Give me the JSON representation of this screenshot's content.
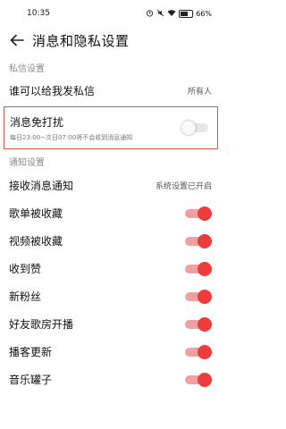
{
  "status_bar": {
    "time": "10:35",
    "battery": "66%",
    "icons": [
      "alarm-icon",
      "mute-icon",
      "wifi-icon",
      "battery-icon"
    ]
  },
  "header": {
    "title": "消息和隐私设置",
    "back_icon": "arrow-left-icon"
  },
  "private_message": {
    "section_title": "私信设置",
    "who_can_message_label": "谁可以给我发私信",
    "who_can_message_value": "所有人"
  },
  "do_not_disturb": {
    "label": "消息免打扰",
    "description": "每日23:00~次日07:00将不会收到消息通知",
    "enabled": false,
    "highlight_color": "#e2574c"
  },
  "notification": {
    "section_title": "通知设置",
    "receive_label": "接收消息通知",
    "receive_value": "系统设置已开启",
    "items": [
      {
        "label": "歌单被收藏",
        "enabled": true
      },
      {
        "label": "视频被收藏",
        "enabled": true
      },
      {
        "label": "收到赞",
        "enabled": true
      },
      {
        "label": "新粉丝",
        "enabled": true
      },
      {
        "label": "好友歌房开播",
        "enabled": true
      },
      {
        "label": "播客更新",
        "enabled": true
      },
      {
        "label": "音乐罐子",
        "enabled": true
      }
    ]
  },
  "colors": {
    "accent": "#ec3c3c",
    "toggle_track_on": "#f0a0a0",
    "toggle_track_off": "#e6e6e6"
  }
}
